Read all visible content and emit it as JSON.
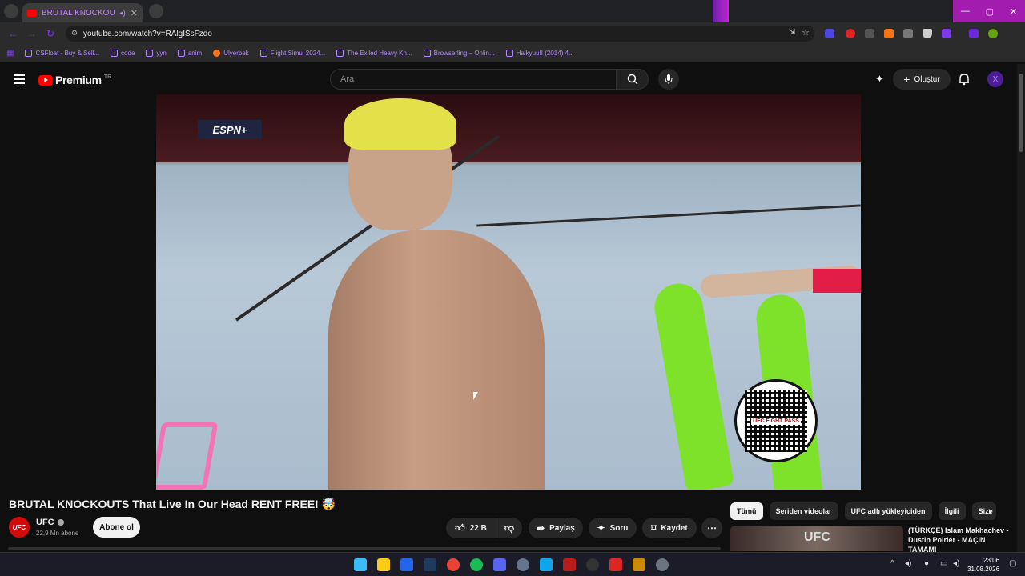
{
  "browser": {
    "tab_title": "BRUTAL KNOCKOUTS That",
    "url": "youtube.com/watch?v=RAlgISsFzdo",
    "bookmarks": [
      "CSFloat - Buy & Sell...",
      "code",
      "yyn",
      "anim",
      "Ulyerbek",
      "Flight Simul 2024...",
      "The Exiled Heavy Kn...",
      "Browserling – Onlin...",
      "Haikyuu!! (2014) 4..."
    ]
  },
  "youtube": {
    "logo_text": "Premium",
    "country": "TR",
    "search_placeholder": "Ara",
    "create_label": "Oluştur",
    "avatar_letter": "X"
  },
  "video": {
    "overlay_network": "ESPN+",
    "qr_label": "UFC FIGHT PASS",
    "title": "BRUTAL KNOCKOUTS That Live In Our Head RENT FREE! 🤯",
    "channel": "UFC",
    "channel_logo": "UFC",
    "subscribers": "22,9 Mn abone",
    "subscribe_label": "Abone ol",
    "likes": "22 B",
    "share_label": "Paylaş",
    "ask_label": "Soru",
    "save_label": "Kaydet"
  },
  "sidebar": {
    "chips": [
      "Tümü",
      "Seriden videolar",
      "UFC adlı yükleyiciden",
      "İlgili",
      "Size"
    ],
    "rec_title": "(TÜRKÇE) Islam Makhachev - Dustin Poirier - MAÇIN TAMAMI"
  },
  "taskbar": {
    "time": "23:06",
    "date": "31.08.2026"
  },
  "colors": {
    "youtube_red": "#ff0000",
    "accent_purple": "#a21caf",
    "bg": "#0f0f0f"
  }
}
